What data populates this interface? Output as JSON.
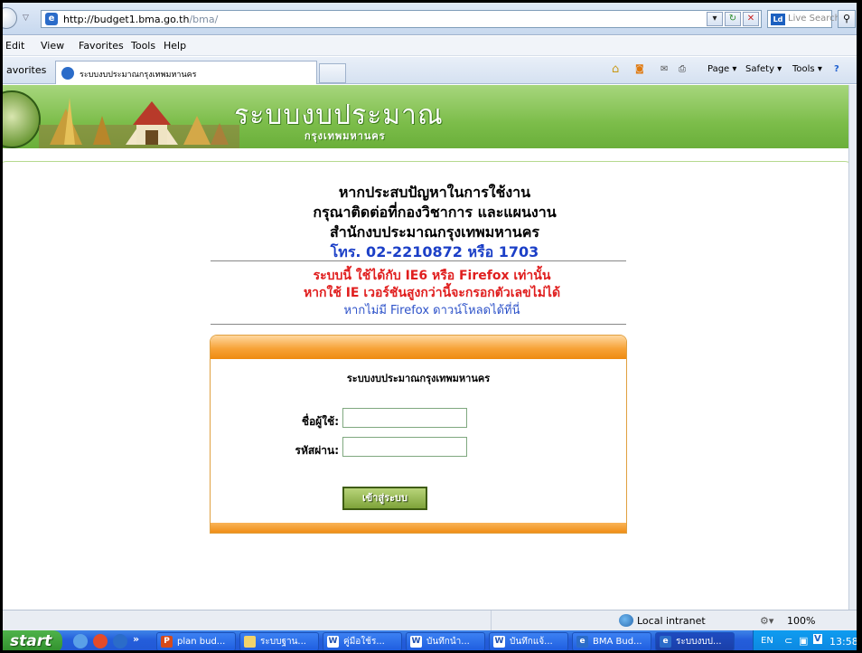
{
  "browser": {
    "url_host": "http://budget1.bma.go.th",
    "url_path": "/bma/",
    "search_placeholder": "Live Search",
    "menu": [
      "Edit",
      "View",
      "Favorites",
      "Tools",
      "Help"
    ],
    "favorites_label": "avorites",
    "tab_title": "ระบบงบประมาณกรุงเทพมหานคร",
    "commands": [
      "Page ▾",
      "Safety ▾",
      "Tools ▾"
    ]
  },
  "banner": {
    "title": "ระบบงบประมาณ",
    "subtitle": "กรุงเทพมหานคร"
  },
  "contact": {
    "lines": [
      "หากประสบปัญหาในการใช้งาน",
      "กรุณาติดต่อที่กองวิชาการ และแผนงาน",
      "สำนักงบประมาณกรุงเทพมหานคร"
    ],
    "phone": "โทร. 02-2210872 หรือ 1703"
  },
  "notice": {
    "line1": "ระบบนี้ ใช้ได้กับ IE6 หรือ Firefox เท่านั้น",
    "line2": "หากใช้ IE เวอร์ชันสูงกว่านี้จะกรอกตัวเลขไม่ได้",
    "download_link": "หากไม่มี Firefox ดาวน์โหลดได้ที่นี่"
  },
  "login": {
    "title": "ระบบงบประมาณกรุงเทพมหานคร",
    "username_label": "ชื่อผู้ใช้:",
    "password_label": "รหัสผ่าน:",
    "username_value": "",
    "password_value": "",
    "submit_label": "เข้าสู่ระบบ"
  },
  "status": {
    "zone": "Local intranet",
    "zoom": "100%"
  },
  "taskbar": {
    "start": "start",
    "tasks": [
      "plan bud...",
      "ระบบฐาน...",
      "คู่มือใช้ร...",
      "บันทึกนำ...",
      "บันทึกแจ้...",
      "BMA Bud...",
      "ระบบงบป..."
    ],
    "lang": "EN",
    "clock": "13:58"
  },
  "colors": {
    "banner_green": "#7cbd4a",
    "notice_red": "#e01e1e",
    "phone_blue": "#1b3fc7",
    "login_orange": "#f7a338",
    "taskbar_blue": "#245edb"
  }
}
